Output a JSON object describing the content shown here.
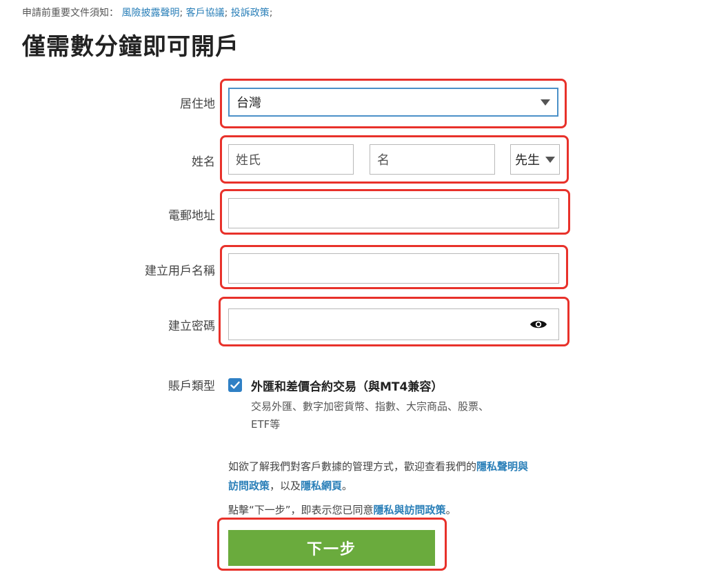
{
  "notice": {
    "prefix": "申請前重要文件須知：",
    "links": [
      "風險披露聲明",
      "客戶協議",
      "投訴政策"
    ],
    "separator": ";"
  },
  "page_title": "僅需數分鐘即可開戶",
  "form": {
    "residence_label": "居住地",
    "residence_value": "台灣",
    "name_label": "姓名",
    "last_name_placeholder": "姓氏",
    "first_name_placeholder": "名",
    "title_value": "先生",
    "email_label": "電郵地址",
    "email_value": "",
    "username_label": "建立用戶名稱",
    "username_value": "",
    "password_label": "建立密碼",
    "password_value": "",
    "account_type_label": "賬戶類型",
    "account_type_option": "外匯和差價合約交易（與MT4兼容）",
    "account_type_checked": true,
    "account_type_desc_line1": "交易外匯、數字加密貨幣、指數、大宗商品、股票、",
    "account_type_desc_line2": "ETF等"
  },
  "privacy": {
    "text_before": "如欲了解我們對客戶數據的管理方式，歡迎查看我們的",
    "link1": "隱私聲明與",
    "link1b": "訪問政策",
    "text_middle": "，以及",
    "link2": "隱私網頁",
    "text_end": "。"
  },
  "consent": {
    "text_before": "點擊“下一步”，即表示您已同意",
    "link": "隱私與訪問政策",
    "text_end": "。"
  },
  "next_button_label": "下一步",
  "colors": {
    "highlight": "#e8312a",
    "link": "#2a7fb8",
    "button": "#6aab3d",
    "checkbox": "#2f80c5"
  }
}
